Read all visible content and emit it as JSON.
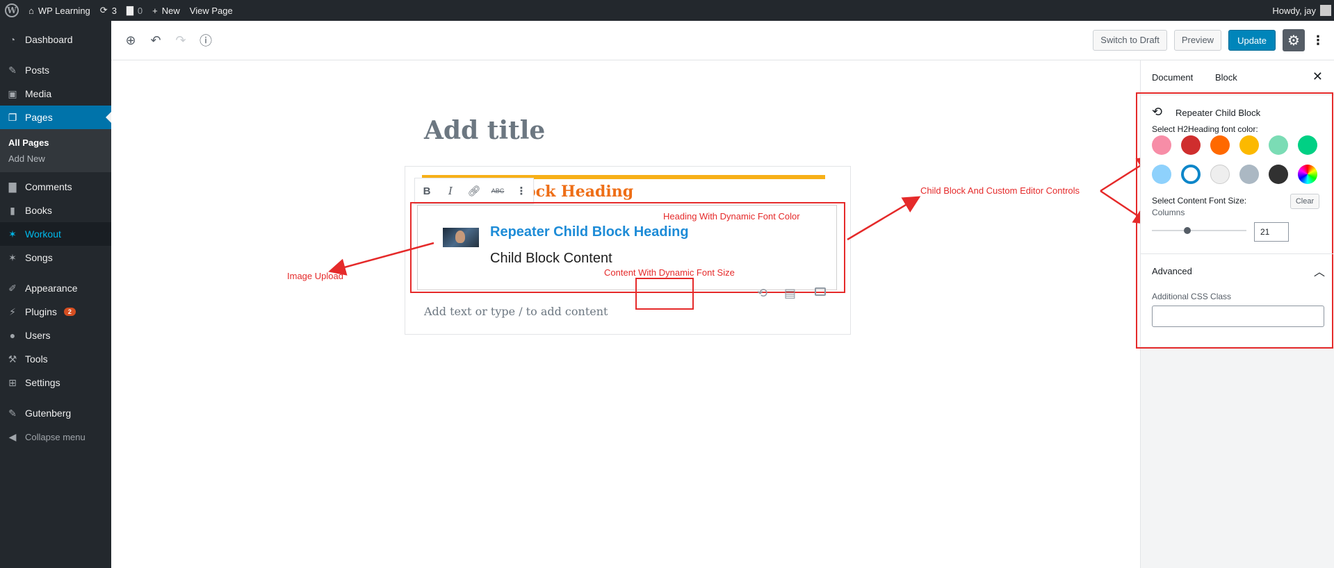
{
  "adminbar": {
    "site_name": "WP Learning",
    "updates_count": "3",
    "comments_count": "0",
    "new_label": "New",
    "view_page_label": "View Page",
    "howdy": "Howdy, jay"
  },
  "sidebar": {
    "dashboard": "Dashboard",
    "posts": "Posts",
    "media": "Media",
    "pages": "Pages",
    "all_pages": "All Pages",
    "add_new": "Add New",
    "comments": "Comments",
    "books": "Books",
    "workout": "Workout",
    "songs": "Songs",
    "appearance": "Appearance",
    "plugins": "Plugins",
    "plugins_badge": "2",
    "users": "Users",
    "tools": "Tools",
    "settings": "Settings",
    "gutenberg": "Gutenberg",
    "collapse": "Collapse menu"
  },
  "header": {
    "switch_to_draft": "Switch to Draft",
    "preview": "Preview",
    "update": "Update"
  },
  "editor": {
    "title_placeholder": "Add title",
    "parent_heading": "ock Heading",
    "child_heading": "Repeater Child Block Heading",
    "child_content": "Child Block Content",
    "add_text_placeholder": "Add text or type / to add content"
  },
  "annotations": {
    "heading_color": "Heading With Dynamic Font Color",
    "content_size": "Content With Dynamic Font Size",
    "image_upload": "Image Upload",
    "child_controls": "Child Block And Custom Editor Controls"
  },
  "inspector": {
    "tab_document": "Document",
    "tab_block": "Block",
    "block_title": "Repeater Child Block",
    "color_label": "Select H2Heading font color:",
    "font_size_label": "Select Content Font Size:",
    "clear_label": "Clear",
    "columns_label": "Columns",
    "columns_value": "21",
    "advanced_label": "Advanced",
    "css_class_label": "Additional CSS Class"
  },
  "colors": {
    "swatches_row1": [
      "#f78da7",
      "#cf2e2e",
      "#ff6900",
      "#fcb900",
      "#7bdcb5",
      "#00d084"
    ],
    "swatches_row2": [
      "#8ed1fc",
      "#0693e3",
      "#eeeeee",
      "#abb8c3",
      "#313131",
      "gradient"
    ],
    "selected_swatch": "#0693e3",
    "annotation_red": "#e52a2a",
    "wp_blue": "#0073aa"
  }
}
